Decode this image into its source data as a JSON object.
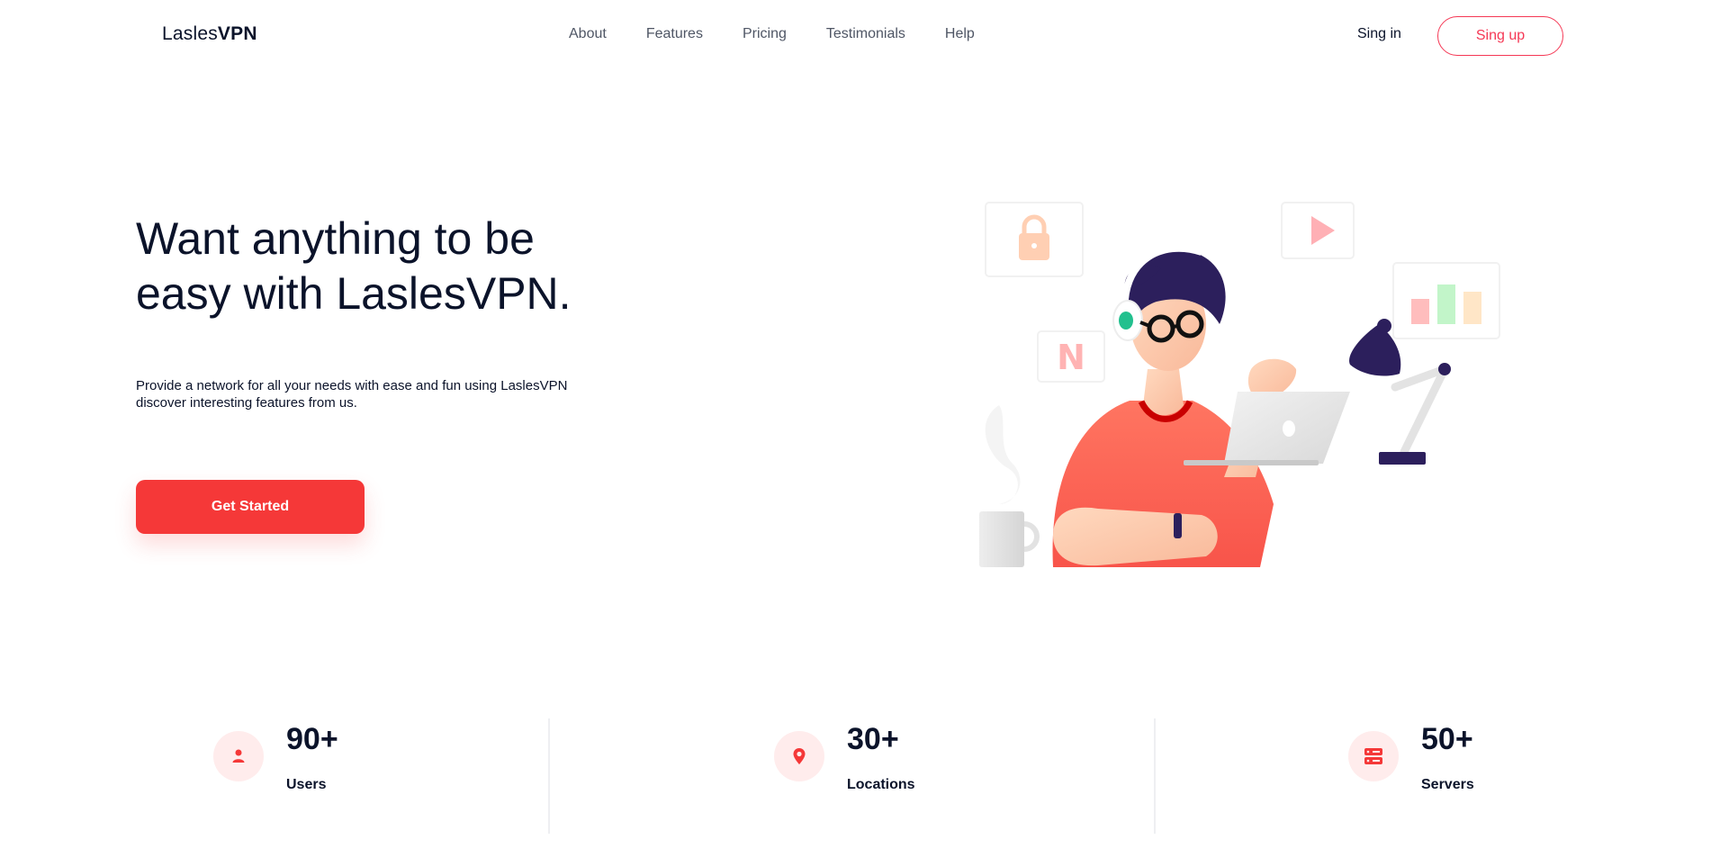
{
  "brand": {
    "name_part1": "Lasles",
    "name_part2": "VPN",
    "accent": "#F53838"
  },
  "nav": {
    "items": [
      {
        "label": "About"
      },
      {
        "label": "Features"
      },
      {
        "label": "Pricing"
      },
      {
        "label": "Testimonials"
      },
      {
        "label": "Help"
      }
    ],
    "signin_label": "Sing in",
    "signup_label": "Sing up"
  },
  "hero": {
    "title_line1": "Want anything to be",
    "title_line2": "easy with LaslesVPN.",
    "desc_line1": "Provide a network for all your needs with ease and fun using LaslesVPN",
    "desc_line2": "discover interesting features from us.",
    "cta_label": "Get Started"
  },
  "illustration": {
    "icons": [
      "lock-icon",
      "play-icon",
      "netflix-icon",
      "bar-chart-icon"
    ],
    "netflix_letter": "N"
  },
  "stats": [
    {
      "value": "90+",
      "label": "Users",
      "icon": "user-icon"
    },
    {
      "value": "30+",
      "label": "Locations",
      "icon": "location-pin-icon"
    },
    {
      "value": "50+",
      "label": "Servers",
      "icon": "server-icon"
    }
  ]
}
